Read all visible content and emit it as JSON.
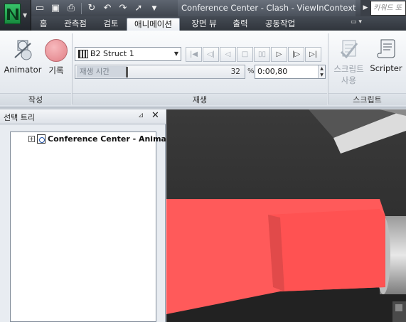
{
  "window": {
    "title": "Conference Center - Clash - ViewInContext....",
    "search_placeholder": "키워드 또"
  },
  "quick_access": [
    "new-icon",
    "open-icon",
    "save-icon",
    "print-icon",
    "refresh-icon",
    "undo-icon",
    "redo-icon",
    "select-arrow-icon",
    "dropdown-icon"
  ],
  "tabs": [
    {
      "label": "홈",
      "active": false
    },
    {
      "label": "관측점",
      "active": false
    },
    {
      "label": "검토",
      "active": false
    },
    {
      "label": "애니메이션",
      "active": true
    },
    {
      "label": "장면 뷰",
      "active": false
    },
    {
      "label": "출력",
      "active": false
    },
    {
      "label": "공동작업",
      "active": false
    }
  ],
  "ribbon": {
    "create": {
      "label": "작성",
      "animator_label": "Animator",
      "record_label": "기록"
    },
    "playback": {
      "label": "재생",
      "animation_select": "B2 Struct 1",
      "time_label": "재생 시간",
      "time_percent": "32",
      "percent_sign": "%",
      "time_value": "0:00,80"
    },
    "script": {
      "label": "스크립트",
      "enable_label": "스크립트\n사용",
      "enable_line1": "스크립트",
      "enable_line2": "사용",
      "scripter_label": "Scripter"
    }
  },
  "selection_tree": {
    "title": "선택 트리",
    "root_item": "Conference Center - Animat"
  },
  "colors": {
    "highlight_red": "#ff5a5a",
    "viewport_bg": "#2e2e2e"
  }
}
